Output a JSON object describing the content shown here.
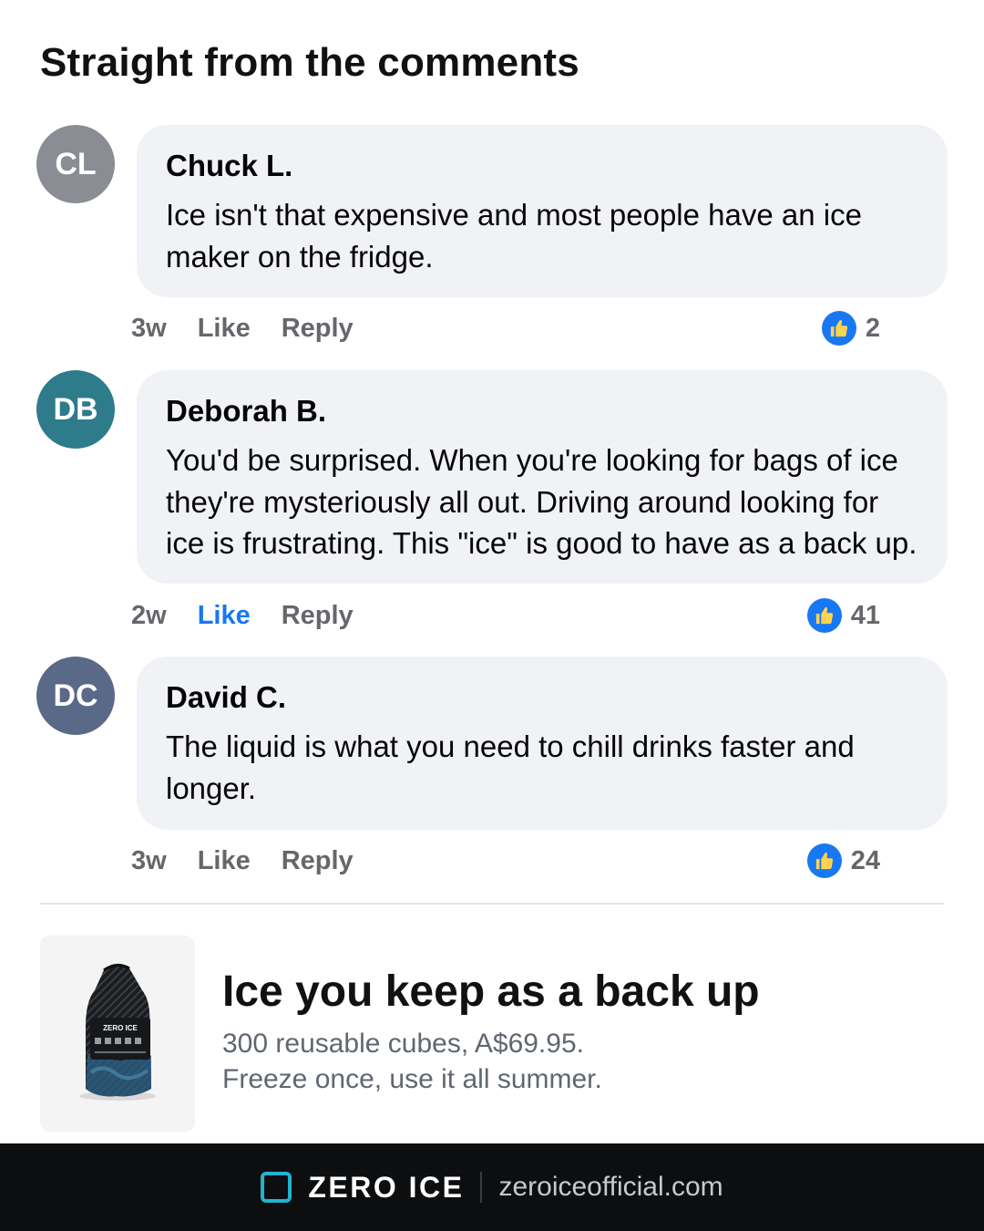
{
  "page_title": "Straight from the comments",
  "comments": [
    {
      "initials": "CL",
      "avatar_color": "#8a8d93",
      "author": "Chuck L.",
      "text": "Ice isn't that expensive and most people have an ice maker on the fridge.",
      "time": "3w",
      "like_label": "Like",
      "like_active": false,
      "reply_label": "Reply",
      "reaction_icon": "thumbs-up-icon",
      "reaction_count": "2"
    },
    {
      "initials": "DB",
      "avatar_color": "#2e7b8c",
      "author": "Deborah B.",
      "text": "You'd be surprised. When you're looking for bags of ice they're mysteriously all out. Driving around looking for ice is frustrating. This \"ice\" is good to have as a back up.",
      "time": "2w",
      "like_label": "Like",
      "like_active": true,
      "reply_label": "Reply",
      "reaction_icon": "thumbs-up-icon",
      "reaction_count": "41"
    },
    {
      "initials": "DC",
      "avatar_color": "#5a6987",
      "author": "David C.",
      "text": "The liquid is what you need to chill drinks faster and longer.",
      "time": "3w",
      "like_label": "Like",
      "like_active": false,
      "reply_label": "Reply",
      "reaction_icon": "thumbs-up-icon",
      "reaction_count": "24"
    }
  ],
  "product": {
    "image_icon": "mesh-bag-product-image",
    "bag_logo_text": "ZERO ICE",
    "headline": "Ice you keep as a back up",
    "line1": "300 reusable cubes, A$69.95.",
    "line2": "Freeze once, use it all summer."
  },
  "footer": {
    "logo_icon": "square-logo-icon",
    "brand": "ZERO ICE",
    "url": "zeroiceofficial.com"
  },
  "colors": {
    "accent": "#1877f2",
    "bubble": "#f0f2f5",
    "brand_accent": "#22b3d0",
    "footer_bg": "#0d0e10"
  }
}
